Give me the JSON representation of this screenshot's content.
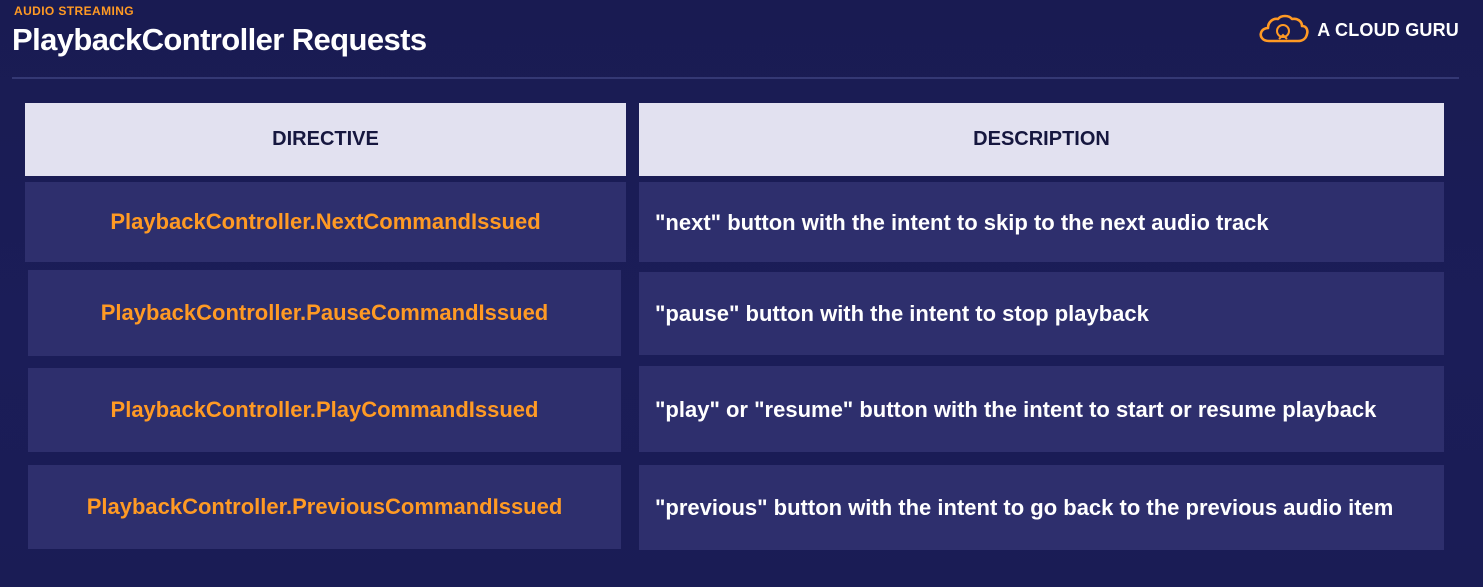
{
  "header": {
    "eyebrow": "AUDIO STREAMING",
    "title": "PlaybackController Requests",
    "brand": "A CLOUD GURU",
    "brand_icon": "cloud-icon"
  },
  "colors": {
    "background": "#1a1c55",
    "accent": "#ff9a24",
    "header_cell": "#e2e1f0",
    "row_cell": "#2e2f6d"
  },
  "table": {
    "columns": [
      "DIRECTIVE",
      "DESCRIPTION"
    ],
    "rows": [
      {
        "directive": "PlaybackController.NextCommandIssued",
        "description": "\"next\" button with the intent to skip to the next audio track"
      },
      {
        "directive": "PlaybackController.PauseCommandIssued",
        "description": "\"pause\" button with the intent to stop playback"
      },
      {
        "directive": "PlaybackController.PlayCommandIssued",
        "description": "\"play\" or \"resume\" button with the intent to start or resume playback"
      },
      {
        "directive": "PlaybackController.PreviousCommandIssued",
        "description": "\"previous\" button with the intent to go back to the previous audio item"
      }
    ]
  }
}
